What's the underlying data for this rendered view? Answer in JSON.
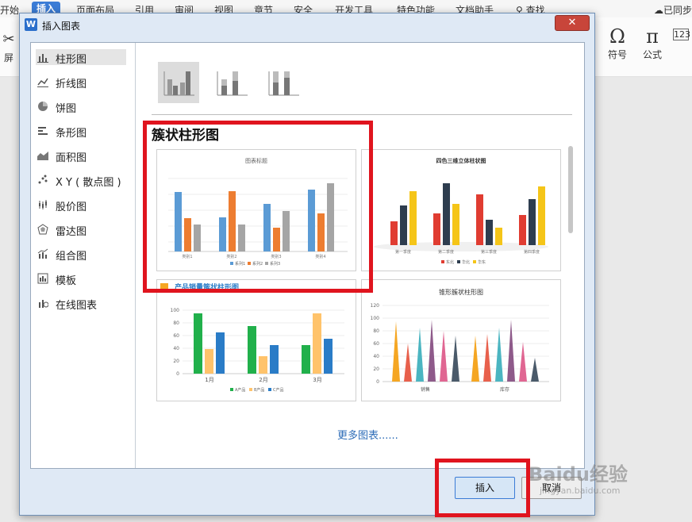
{
  "menu": {
    "items": [
      "开始",
      "插入",
      "页面布局",
      "引用",
      "审阅",
      "视图",
      "章节",
      "安全",
      "开发工具",
      "特色功能",
      "文档助手"
    ],
    "search_label": "查找",
    "sync_label": "已同步"
  },
  "ribbon": {
    "left_label": "屏",
    "symbol_label": "符号",
    "formula_label": "公式"
  },
  "dialog": {
    "title": "插入图表",
    "close_glyph": "✕",
    "sidebar": [
      {
        "label": "柱形图",
        "icon": "bar-chart-icon"
      },
      {
        "label": "折线图",
        "icon": "line-chart-icon"
      },
      {
        "label": "饼图",
        "icon": "pie-chart-icon"
      },
      {
        "label": "条形图",
        "icon": "horizontal-bar-icon"
      },
      {
        "label": "面积图",
        "icon": "area-chart-icon"
      },
      {
        "label": "X Y ( 散点图 )",
        "icon": "scatter-icon"
      },
      {
        "label": "股价图",
        "icon": "stock-chart-icon"
      },
      {
        "label": "雷达图",
        "icon": "radar-chart-icon"
      },
      {
        "label": "组合图",
        "icon": "combo-chart-icon"
      },
      {
        "label": "模板",
        "icon": "template-icon"
      },
      {
        "label": "在线图表",
        "icon": "online-chart-icon"
      }
    ],
    "section_title": "簇状柱形图",
    "more_link": "更多图表......",
    "insert_label": "插入",
    "cancel_label": "取消",
    "thumbnails": [
      {
        "title": "图表标题",
        "legend": [
          "系列1",
          "系列2",
          "系列3"
        ],
        "categories": [
          "类别1",
          "类别2",
          "类别3",
          "类别4"
        ],
        "colors": [
          "#5b9bd5",
          "#ed7d31",
          "#a5a5a5"
        ]
      },
      {
        "title": "四色三维立体柱状图",
        "legend": [
          "东北",
          "华北",
          "华东"
        ],
        "categories": [
          "第一季度",
          "第二季度",
          "第三季度",
          "第四季度"
        ],
        "colors": [
          "#e03c31",
          "#2e3d4f",
          "#f5c518"
        ]
      },
      {
        "title": "产品销量簇状柱形图",
        "legend": [
          "A产品",
          "B产品",
          "C产品"
        ],
        "categories": [
          "1月",
          "2月",
          "3月"
        ],
        "colors": [
          "#21b04b",
          "#ffc36b",
          "#2a7cc7"
        ]
      },
      {
        "title": "锥形簇状柱形图",
        "categories": [
          "销售",
          "库存"
        ],
        "colors": [
          "#f5a623",
          "#e8604c",
          "#4bb5c1",
          "#8e5a8a",
          "#e06692",
          "#4a5a6a"
        ]
      }
    ]
  },
  "watermark": {
    "text": "Baidu经验",
    "sub": "jingyan.baidu.com"
  }
}
